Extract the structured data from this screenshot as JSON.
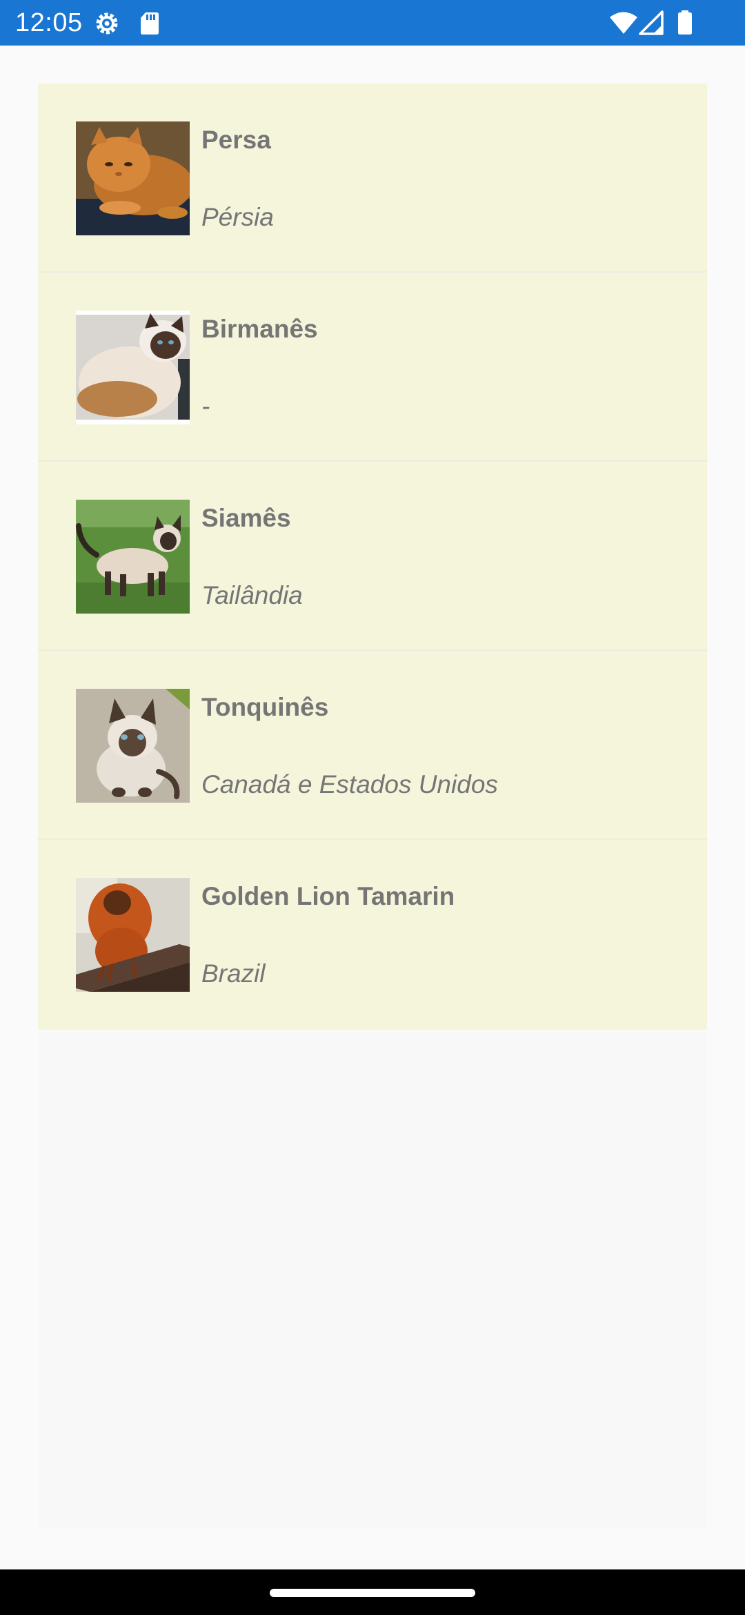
{
  "status_bar": {
    "time": "12:05",
    "background_color": "#1976d2",
    "icons": [
      "settings-gear-icon",
      "sd-card-icon",
      "wifi-icon",
      "cell-signal-icon",
      "battery-icon"
    ]
  },
  "list": {
    "background_color": "#f5f5dc",
    "text_color": "#757575",
    "items": [
      {
        "name": "Persa",
        "origin": "Pérsia",
        "image_icon": "persian-cat-photo"
      },
      {
        "name": "Birmanês",
        "origin": "-",
        "image_icon": "birman-cat-photo"
      },
      {
        "name": "Siamês",
        "origin": "Tailândia",
        "image_icon": "siamese-cat-photo"
      },
      {
        "name": "Tonquinês",
        "origin": "Canadá e Estados Unidos",
        "image_icon": "tonkinese-cat-photo"
      },
      {
        "name": "Golden Lion Tamarin",
        "origin": "Brazil",
        "image_icon": "golden-lion-tamarin-photo"
      }
    ]
  },
  "navigation_bar": {
    "icons": [
      "home-handle"
    ]
  }
}
